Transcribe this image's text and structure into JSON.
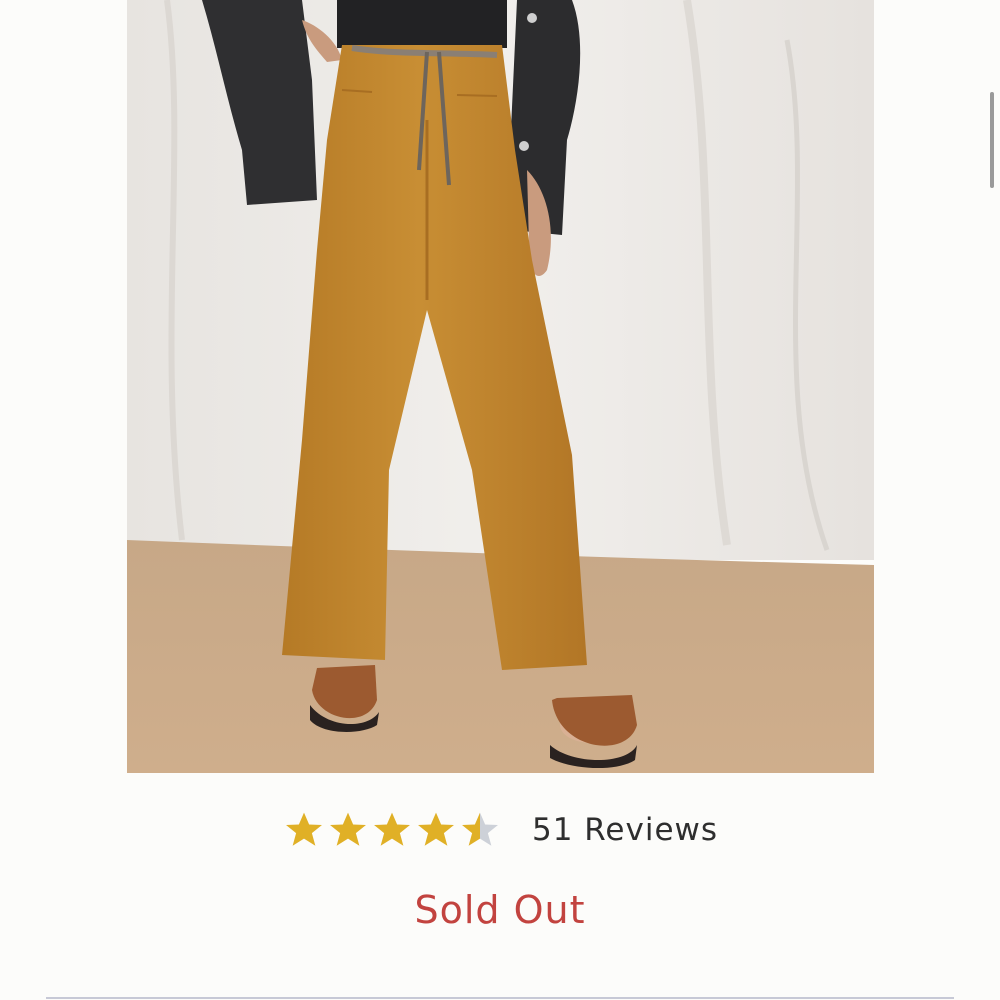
{
  "product": {
    "image_alt": "Model wearing wide-leg mustard pants with a drawstring belt and brown buckled sandals",
    "rating_value": 4.5,
    "rating_max": 5,
    "reviews_label": "51 Reviews",
    "availability": "Sold Out"
  },
  "colors": {
    "star_filled": "#e0b026",
    "star_empty": "#cdd1d8",
    "sold_out": "#c2433f",
    "pants": "#c0852e"
  },
  "icons": {
    "star": "star-icon",
    "half_star": "star-half-icon"
  }
}
